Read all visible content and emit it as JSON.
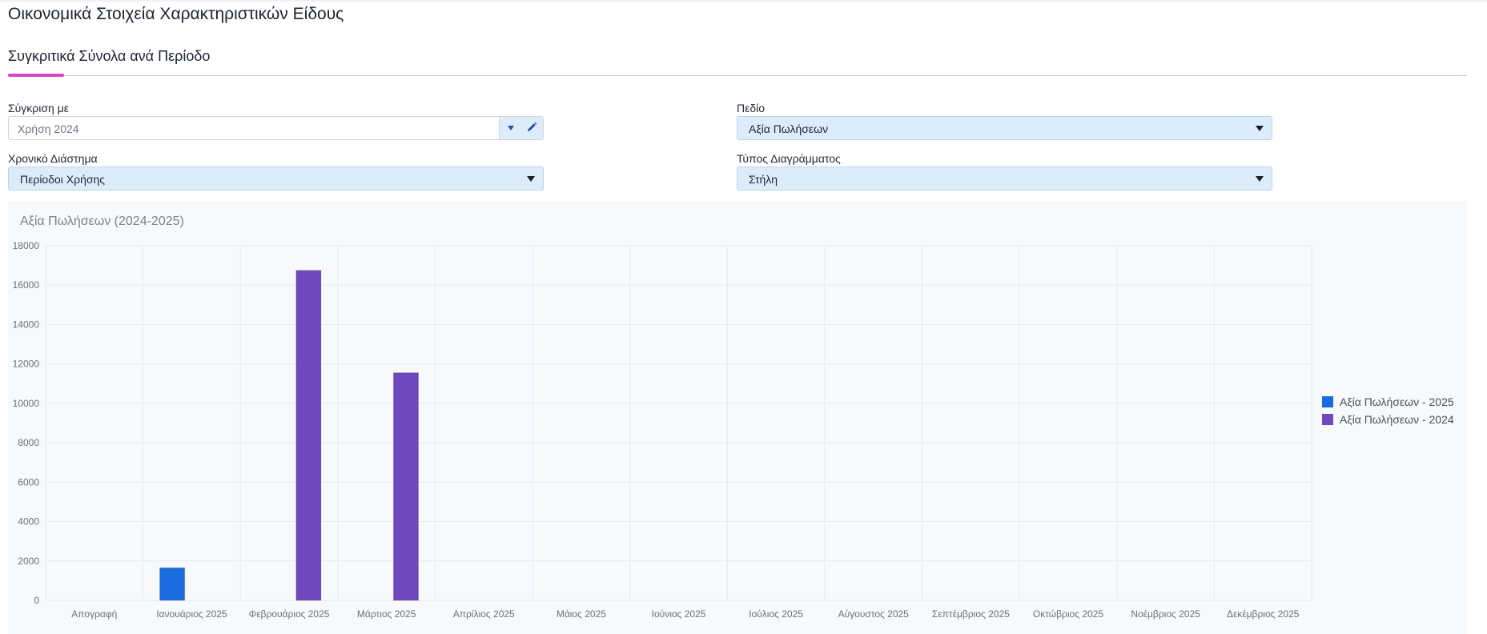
{
  "page": {
    "title": "Οικονομικά Στοιχεία Χαρακτηριστικών Είδους",
    "section_title": "Συγκριτικά Σύνολα ανά Περίοδο"
  },
  "filters": {
    "compare_label": "Σύγκριση με",
    "compare_value": "Χρήση 2024",
    "field_label": "Πεδίο",
    "field_value": "Αξία Πωλήσεων",
    "period_label": "Χρονικό Διάστημα",
    "period_value": "Περίοδοι Χρήσης",
    "chart_type_label": "Τύπος Διαγράμματος",
    "chart_type_value": "Στήλη"
  },
  "icons": {
    "compare_dropdown": "chevron-down-icon",
    "compare_edit": "pencil-icon",
    "select_caret": "caret-down-icon"
  },
  "chart_data": {
    "type": "bar",
    "title": "Αξία Πωλήσεων (2024-2025)",
    "xlabel": "",
    "ylabel": "",
    "ylim": [
      0,
      18000
    ],
    "yticks": [
      0,
      2000,
      4000,
      6000,
      8000,
      10000,
      12000,
      14000,
      16000,
      18000
    ],
    "grid": true,
    "legend_position": "right",
    "categories": [
      "Απογραφή",
      "Ιανουάριος 2025",
      "Φεβρουάριος 2025",
      "Μάρτιος 2025",
      "Απρίλιος 2025",
      "Μάιος 2025",
      "Ιούνιος 2025",
      "Ιούλιος 2025",
      "Αύγουστος 2025",
      "Σεπτέμβριος 2025",
      "Οκτώβριος 2025",
      "Νοέμβριος 2025",
      "Δεκέμβριος 2025"
    ],
    "series": [
      {
        "name": "Αξία Πωλήσεων - 2025",
        "color": "#1a6be0",
        "values": [
          0,
          1650,
          0,
          0,
          0,
          0,
          0,
          0,
          0,
          0,
          0,
          0,
          0
        ]
      },
      {
        "name": "Αξία Πωλήσεων - 2024",
        "color": "#6f48bd",
        "values": [
          0,
          0,
          16750,
          11550,
          0,
          0,
          0,
          0,
          0,
          0,
          0,
          0,
          0
        ]
      }
    ]
  }
}
